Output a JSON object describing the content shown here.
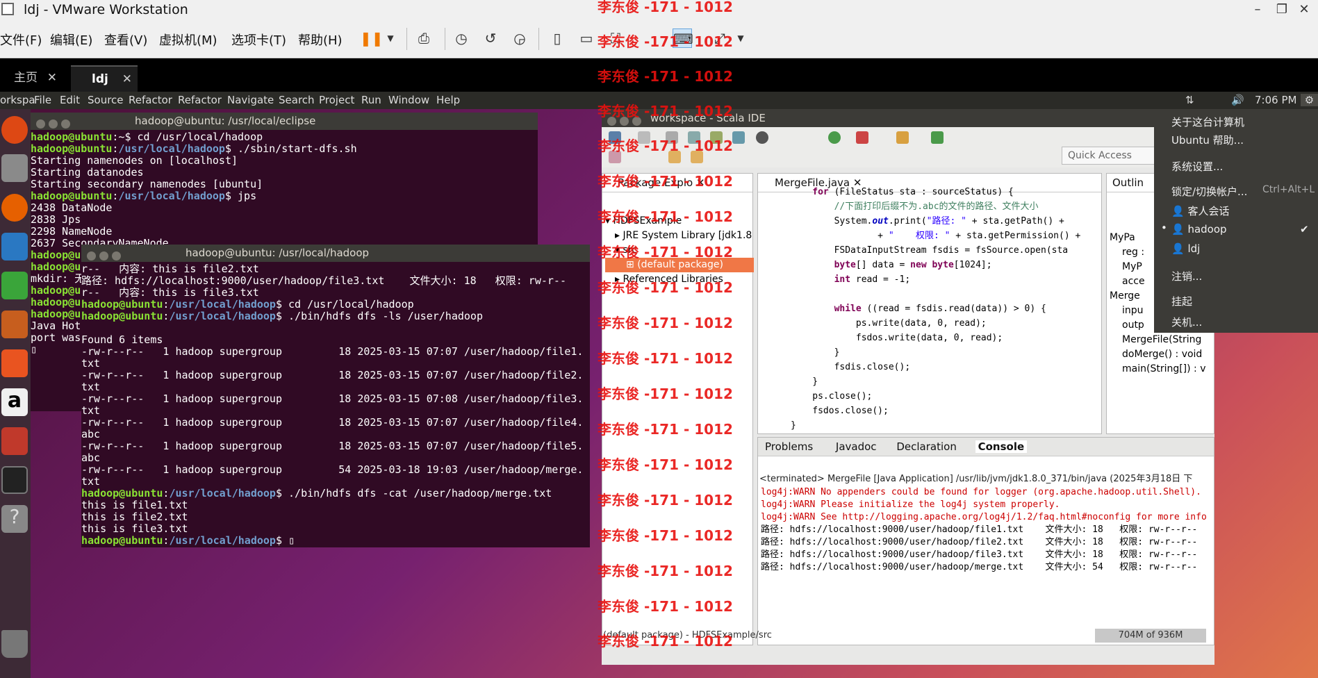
{
  "window": {
    "title": "ldj - VMware Workstation",
    "min": "–",
    "max": "❐",
    "close": "✕"
  },
  "vmmenu": [
    "文件(F)",
    "编辑(E)",
    "查看(V)",
    "虚拟机(M)",
    "选项卡(T)",
    "帮助(H)"
  ],
  "tabs": [
    {
      "label": "主页",
      "close": "✕"
    },
    {
      "label": "ldj",
      "close": "✕"
    }
  ],
  "ubuntu_menu": [
    "orkspa",
    "File",
    "Edit",
    "Source",
    "Refactor",
    "Refactor",
    "Navigate",
    "Search",
    "Project",
    "Run",
    "Window",
    "Help"
  ],
  "tray": {
    "time": "7:06 PM"
  },
  "term1": {
    "title": "hadoop@ubuntu: /usr/local/eclipse"
  },
  "term2": {
    "title": "hadoop@ubuntu: /usr/local/hadoop"
  },
  "eclipse": {
    "title": "workspace - Scala IDE",
    "quick_access": "Quick Access",
    "pkg_tab": "Package Explo",
    "tree": [
      "HDFSExample",
      "JRE System Library [jdk1.8",
      "src",
      "(default package)",
      "Referenced Libraries"
    ],
    "editor_tab": "MergeFile.java",
    "outline_tab": "Outlin",
    "outline": [
      "MyPa",
      "reg :",
      "MyP",
      "acce",
      "Merge",
      "inpu",
      "outp",
      "MergeFile(String",
      "doMerge() : void",
      "main(String[]) : v"
    ],
    "bottom_tabs": [
      "Problems",
      "Javadoc",
      "Declaration",
      "Console"
    ],
    "console_header": "<terminated> MergeFile [Java Application] /usr/lib/jvm/jdk1.8.0_371/bin/java (2025年3月18日 下",
    "console": [
      "log4j:WARN No appenders could be found for logger (org.apache.hadoop.util.Shell).",
      "log4j:WARN Please initialize the log4j system properly.",
      "log4j:WARN See http://logging.apache.org/log4j/1.2/faq.html#noconfig for more info",
      "路径: hdfs://localhost:9000/user/hadoop/file1.txt    文件大小: 18   权限: rw-r--r--",
      "路径: hdfs://localhost:9000/user/hadoop/file2.txt    文件大小: 18   权限: rw-r--r--",
      "路径: hdfs://localhost:9000/user/hadoop/file3.txt    文件大小: 18   权限: rw-r--r--",
      "路径: hdfs://localhost:9000/user/hadoop/merge.txt    文件大小: 54   权限: rw-r--r--"
    ],
    "status": "(default package) - HDFSExample/src",
    "memory": "704M of 936M"
  },
  "user_menu": [
    "关于这台计算机",
    "Ubuntu 帮助...",
    "系统设置...",
    "锁定/切换帐户...",
    "Ctrl+Alt+L",
    "客人会话",
    "hadoop",
    "ldj",
    "注销...",
    "挂起",
    "关机..."
  ],
  "watermark": "李东俊 -171 - 1012"
}
